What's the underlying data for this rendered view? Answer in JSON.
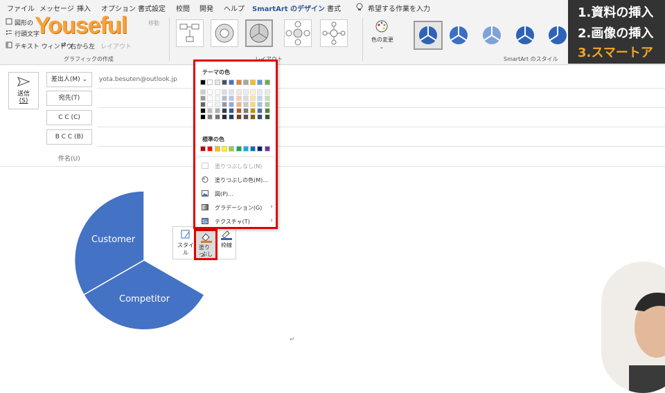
{
  "ribbon": {
    "tabs": [
      "ファイル",
      "メッセージ",
      "挿入",
      "オプション",
      "書式設定",
      "校閲",
      "開発",
      "ヘルプ",
      "SmartArt のデザイン",
      "書式"
    ],
    "active_tab": "SmartArt のデザイン",
    "tell_me": "希望する作業を入力",
    "create_graphic": {
      "add_shape": "図形の",
      "add_bullet": "行頭文字",
      "text_pane": "テキスト ウィンドウ",
      "right_to_left": "右から左",
      "layout_btn": "レイアウト",
      "move": "移動",
      "label": "グラフィックの作成"
    },
    "layouts_label": "レイアウト",
    "change_colors": "色の変更",
    "styles_label": "SmartArt のスタイル"
  },
  "logo": {
    "text": "Youseful"
  },
  "overlay": {
    "lines": [
      "1.資料の挿入",
      "2.画像の挿入",
      "3.スマートア"
    ]
  },
  "email": {
    "send_label": "送信",
    "send_shortcut": "(S)",
    "from_button": "差出人(M)",
    "from_address": "yota.besuten@outlook.jp",
    "to_button": "宛先(T)",
    "cc_button": "C C (C)",
    "bcc_button": "B C C (B)",
    "subject_label": "件名(U)"
  },
  "fill_menu": {
    "theme_colors_title": "テーマの色",
    "standard_colors_title": "標準の色",
    "theme_top_row": [
      "#000000",
      "#ffffff",
      "#e7e6e6",
      "#44546a",
      "#4472c4",
      "#ed7d31",
      "#a5a5a5",
      "#ffc000",
      "#5b9bd5",
      "#70ad47"
    ],
    "standard_colors": [
      "#c00000",
      "#ff0000",
      "#ffc000",
      "#ffff00",
      "#92d050",
      "#00b050",
      "#00b0f0",
      "#0070c0",
      "#002060",
      "#7030a0"
    ],
    "items": [
      {
        "label": "塗りつぶしなし(N)",
        "icon": "no-fill-icon",
        "disabled": true
      },
      {
        "label": "塗りつぶしの色(M)...",
        "icon": "palette-icon"
      },
      {
        "label": "図(P)...",
        "icon": "picture-icon"
      },
      {
        "label": "グラデーション(G)",
        "icon": "gradient-icon",
        "submenu": true
      },
      {
        "label": "テクスチャ(T)",
        "icon": "texture-icon",
        "submenu": true
      }
    ]
  },
  "mini_toolbar": {
    "style_label": "スタイル",
    "fill_label_1": "塗りつ",
    "fill_label_2": "ぶし",
    "outline_label": "枠線"
  },
  "diagram": {
    "segments": [
      "Customer",
      "Competitor"
    ],
    "color": "#4472c4"
  },
  "paragraph_mark": "↵"
}
